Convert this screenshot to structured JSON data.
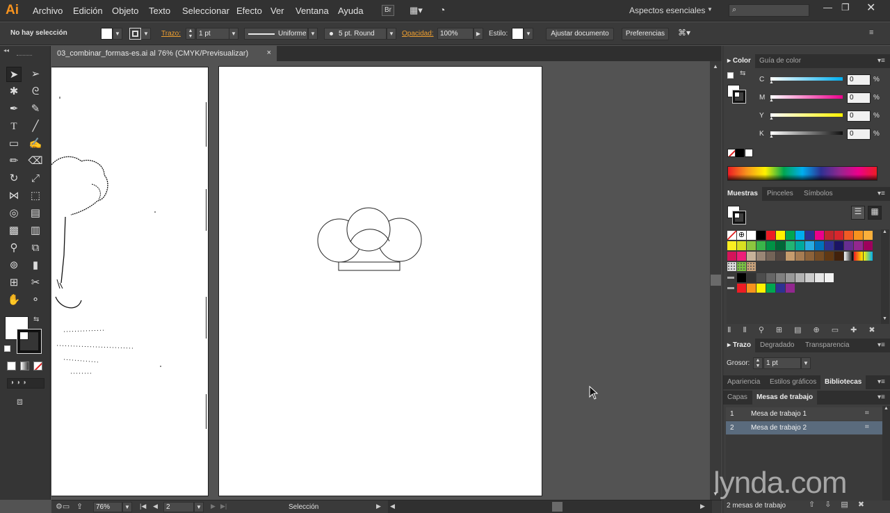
{
  "app": {
    "logo": "Ai"
  },
  "menu": [
    "Archivo",
    "Edición",
    "Objeto",
    "Texto",
    "Seleccionar",
    "Efecto",
    "Ver",
    "Ventana",
    "Ayuda"
  ],
  "bridge_label": "Br",
  "workspace": "Aspectos esenciales",
  "search": {
    "placeholder": ""
  },
  "control": {
    "selection_status": "No hay selección",
    "stroke_label": "Trazo:",
    "stroke_weight": "1 pt",
    "profile": "Uniforme",
    "brush": "5 pt. Round",
    "opacity_label": "Opacidad:",
    "opacity": "100%",
    "style_label": "Estilo:",
    "fit_document_button": "Ajustar documento",
    "preferences_button": "Preferencias"
  },
  "document": {
    "tab_title": "03_combinar_formas-es.ai al 76% (CMYK/Previsualizar)",
    "close": "×"
  },
  "status": {
    "zoom": "76%",
    "artboard": "2",
    "tool": "Selección"
  },
  "color_panel": {
    "tabs": [
      "Color",
      "Guía de color"
    ],
    "channels": [
      {
        "label": "C",
        "value": "0",
        "unit": "%"
      },
      {
        "label": "M",
        "value": "0",
        "unit": "%"
      },
      {
        "label": "Y",
        "value": "0",
        "unit": "%"
      },
      {
        "label": "K",
        "value": "0",
        "unit": "%"
      }
    ]
  },
  "swatches_panel": {
    "tabs": [
      "Muestras",
      "Pinceles",
      "Símbolos"
    ]
  },
  "stroke_panel": {
    "tabs": [
      "Trazo",
      "Degradado",
      "Transparencia"
    ],
    "weight_label": "Grosor:",
    "weight": "1 pt"
  },
  "libraries_panel": {
    "tabs": [
      "Apariencia",
      "Estilos gráficos",
      "Bibliotecas"
    ]
  },
  "artboards_panel": {
    "tabs": [
      "Capas",
      "Mesas de trabajo"
    ],
    "rows": [
      {
        "num": "1",
        "name": "Mesa de trabajo 1"
      },
      {
        "num": "2",
        "name": "Mesa de trabajo 2"
      }
    ],
    "footer": "2 mesas de trabajo"
  },
  "watermark": "lynda.com",
  "colors": {
    "accent": "#f7931e",
    "selected_row": "#5a6b7d"
  }
}
